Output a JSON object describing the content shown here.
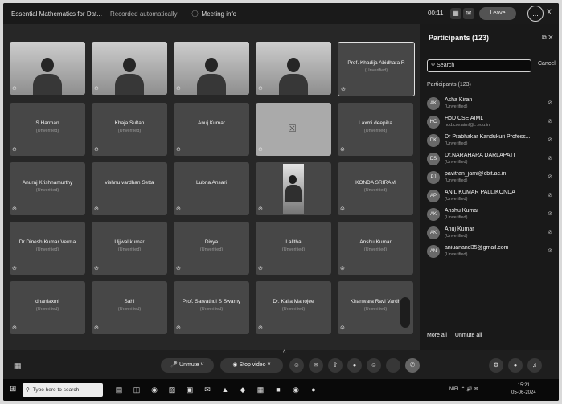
{
  "topbar": {
    "title": "Essential Mathematics for Dat...",
    "subtitle": "Recorded automatically",
    "meeting_info": "Meeting info",
    "timer": "00:11",
    "leave_label": "Leave",
    "more_label": "...",
    "close_label": "X"
  },
  "tiles": [
    {
      "type": "video",
      "name": "",
      "status": ""
    },
    {
      "type": "video",
      "name": "",
      "status": ""
    },
    {
      "type": "video",
      "name": "",
      "status": ""
    },
    {
      "type": "video",
      "name": "",
      "status": ""
    },
    {
      "type": "name",
      "name": "Prof. Khadija Abidhara R",
      "status": "(Unverified)",
      "highlight": true
    },
    {
      "type": "name",
      "name": "S Harman",
      "status": "(Unverified)"
    },
    {
      "type": "name",
      "name": "Khaja Sultan",
      "status": "(Unverified)"
    },
    {
      "type": "name",
      "name": "Anuj Kumar",
      "status": ""
    },
    {
      "type": "icon",
      "name": "",
      "status": ""
    },
    {
      "type": "name",
      "name": "Laxmi deepika",
      "status": "(Unverified)"
    },
    {
      "type": "name",
      "name": "Anuraj Krishnamurthy",
      "status": "(Unverified)"
    },
    {
      "type": "name",
      "name": "vishnu vardhan Setta",
      "status": ""
    },
    {
      "type": "name",
      "name": "Lubna Ansari",
      "status": ""
    },
    {
      "type": "portrait",
      "name": "",
      "status": ""
    },
    {
      "type": "name",
      "name": "KONDA SRIRAM",
      "status": "(Unverified)"
    },
    {
      "type": "name",
      "name": "Dr Dinesh Kumar Verma",
      "status": "(Unverified)"
    },
    {
      "type": "name",
      "name": "Ujjwal kumar",
      "status": "(Unverified)"
    },
    {
      "type": "name",
      "name": "Divya",
      "status": "(Unverified)"
    },
    {
      "type": "name",
      "name": "Lalitha",
      "status": "(Unverified)"
    },
    {
      "type": "name",
      "name": "Anshu Kumar",
      "status": "(Unverified)"
    },
    {
      "type": "name",
      "name": "dhanlaxmi",
      "status": "(Unverified)"
    },
    {
      "type": "name",
      "name": "Sahi",
      "status": "(Unverified)"
    },
    {
      "type": "name",
      "name": "Prof. Sarvathul S Swamy",
      "status": "(Unverified)"
    },
    {
      "type": "name",
      "name": "Dr. Kalla Manojee",
      "status": "(Unverified)"
    },
    {
      "type": "name",
      "name": "Khanwara Ravi Vardh",
      "status": "(Unverified)",
      "sideicons": true
    }
  ],
  "panel": {
    "title": "Participants (123)",
    "search_placeholder": "Search",
    "cancel_label": "Cancel",
    "section_label": "Participants (123)",
    "participants": [
      {
        "initials": "AK",
        "name": "Asha Kiran",
        "sub": "(Unverified)"
      },
      {
        "initials": "HC",
        "name": "HoD CSE AIML",
        "sub": "hod.cse.aiml@...edu.in"
      },
      {
        "initials": "DK",
        "name": "Dr Prabhakar Kandukuri Profess...",
        "sub": "(Unverified)"
      },
      {
        "initials": "DS",
        "name": "Dr.NARAHARA DARLAPATI",
        "sub": "(Unverified)"
      },
      {
        "initials": "PJ",
        "name": "pavitran_jami@cbit.ac.in",
        "sub": "(Unverified)"
      },
      {
        "initials": "AP",
        "name": "ANIL KUMAR PALLIKONDA",
        "sub": "(Unverified)"
      },
      {
        "initials": "AK",
        "name": "Anshu Kumar",
        "sub": "(Unverified)"
      },
      {
        "initials": "AK",
        "name": "Anuj Kumar",
        "sub": "(Unverified)"
      },
      {
        "initials": "AN",
        "name": "aniuanand35@gmail.com",
        "sub": "(Unverified)"
      }
    ],
    "more_label": "More all",
    "unmute_label": "Unmute all"
  },
  "toolbar": {
    "unmute_label": "Unmute",
    "video_label": "Stop video",
    "caret": "^"
  },
  "taskbar": {
    "search_placeholder": "Type here to search",
    "tray_text": "NIFL",
    "time": "15:21",
    "date": "05-06-2024"
  }
}
